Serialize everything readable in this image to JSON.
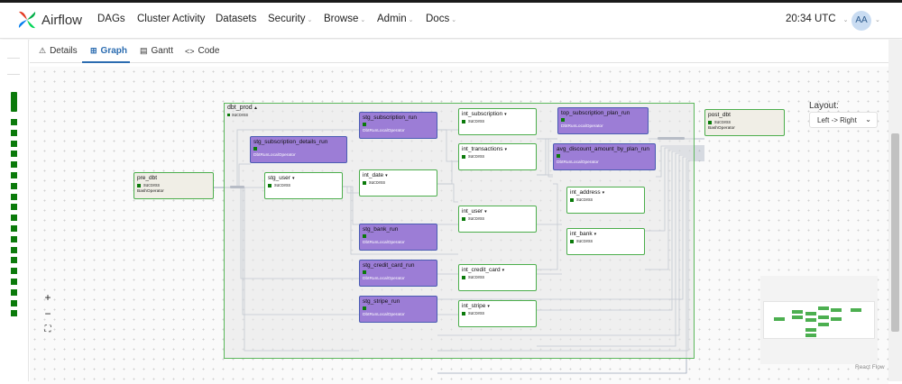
{
  "brand": {
    "name": "Airflow"
  },
  "nav": {
    "items": [
      {
        "label": "DAGs",
        "dropdown": false
      },
      {
        "label": "Cluster Activity",
        "dropdown": false
      },
      {
        "label": "Datasets",
        "dropdown": false
      },
      {
        "label": "Security",
        "dropdown": true
      },
      {
        "label": "Browse",
        "dropdown": true
      },
      {
        "label": "Admin",
        "dropdown": true
      },
      {
        "label": "Docs",
        "dropdown": true
      }
    ],
    "time": "20:34 UTC",
    "avatar_initials": "AA"
  },
  "tabs": [
    {
      "label": "Details",
      "icon": "warning-icon",
      "glyph": "⚠"
    },
    {
      "label": "Graph",
      "icon": "graph-icon",
      "glyph": "⊞",
      "active": true
    },
    {
      "label": "Gantt",
      "icon": "gantt-icon",
      "glyph": "▤"
    },
    {
      "label": "Code",
      "icon": "code-icon",
      "glyph": "<>"
    }
  ],
  "graph": {
    "task_group": {
      "title": "dbt_prod",
      "status": "success"
    },
    "nodes": {
      "pre_dbt": {
        "title": "pre_dbt",
        "status": "success",
        "operator": "BashOperator"
      },
      "post_dbt": {
        "title": "post_dbt",
        "status": "success",
        "operator": "BashOperator"
      },
      "stg_subscription_run": {
        "title": "stg_subscription_run",
        "operator": "DbtRunLocalOperator"
      },
      "stg_subscription_details_run": {
        "title": "stg_subscription_details_run",
        "operator": "DbtRunLocalOperator"
      },
      "stg_user": {
        "title": "stg_user",
        "status": "success"
      },
      "int_subscription": {
        "title": "int_subscription",
        "status": "success"
      },
      "int_transactions": {
        "title": "int_transactions",
        "status": "success"
      },
      "int_date": {
        "title": "int_date",
        "status": "success"
      },
      "top_subscription_plan_run": {
        "title": "top_subscription_plan_run",
        "operator": "DbtRunLocalOperator"
      },
      "avg_discount_amount_by_plan_run": {
        "title": "avg_discount_amount_by_plan_run",
        "operator": "DbtRunLocalOperator"
      },
      "int_address": {
        "title": "int_address",
        "status": "success"
      },
      "int_user": {
        "title": "int_user",
        "status": "success"
      },
      "stg_bank_run": {
        "title": "stg_bank_run",
        "operator": "DbtRunLocalOperator"
      },
      "int_bank": {
        "title": "int_bank",
        "status": "success"
      },
      "stg_credit_card_run": {
        "title": "stg_credit_card_run",
        "operator": "DbtRunLocalOperator"
      },
      "int_credit_card": {
        "title": "int_credit_card",
        "status": "success"
      },
      "stg_stripe_run": {
        "title": "stg_stripe_run",
        "operator": "DbtRunLocalOperator"
      },
      "int_stripe": {
        "title": "int_stripe",
        "status": "success"
      }
    },
    "layout_label": "Layout:",
    "layout_value": "Left -> Right",
    "controls": {
      "zoom_in": "+",
      "zoom_out": "−",
      "fit": "⛶"
    },
    "attribution": "React Flow"
  },
  "colors": {
    "success": "#0b7a0b",
    "group_border": "#5cb85c",
    "operator_node": "#9c7dd6",
    "operator_border": "#4a5cb3",
    "active_tab": "#2b6cb0"
  }
}
